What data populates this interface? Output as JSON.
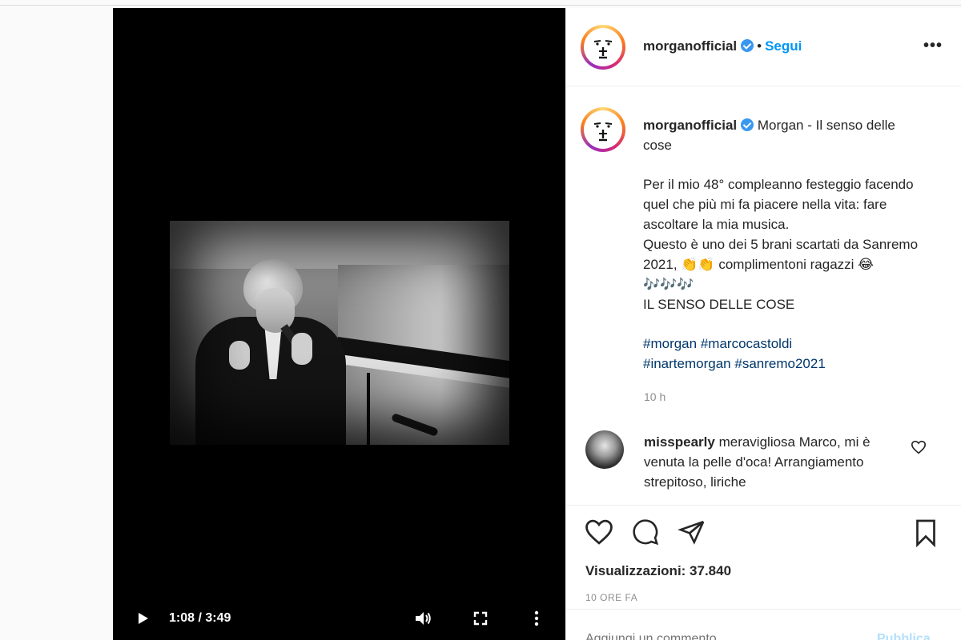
{
  "post": {
    "username": "morganofficial",
    "follow_label": "Segui",
    "more_label": "•••",
    "caption_title": "Morgan - Il senso delle cose",
    "caption_lines": [
      "Per il mio 48° compleanno festeggio facendo quel che più mi fa piacere nella vita: fare ascoltare la mia musica.",
      "Questo è uno dei 5 brani scartati da Sanremo 2021, 👏👏 complimentoni ragazzi 😂🎶🎶🎶",
      "IL SENSO DELLE COSE"
    ],
    "hashtags_line1": [
      "#morgan",
      "#marcocastoldi"
    ],
    "hashtags_line2": [
      "#inartemorgan",
      "#sanremo2021"
    ],
    "posted_time": "10 h"
  },
  "comment": {
    "username": "misspearly",
    "text": "meravigliosa Marco, mi è venuta la pelle d'oca! Arrangiamento strepitoso, liriche"
  },
  "stats": {
    "views_label": "Visualizzazioni: 37.840",
    "ago_label": "10 ORE FA"
  },
  "add_comment": {
    "placeholder": "Aggiungi un commento...",
    "publish_label": "Pubblica"
  },
  "video": {
    "time_label": "1:08 / 3:49"
  },
  "icons": {
    "verified": "verified-badge-icon",
    "like": "heart-icon",
    "comment": "comment-icon",
    "share": "paper-plane-icon",
    "save": "bookmark-icon",
    "play": "play-icon",
    "volume": "volume-icon",
    "fullscreen": "fullscreen-icon",
    "more": "more-vertical-icon"
  },
  "colors": {
    "link_blue": "#0095f6",
    "verified_blue": "#3897f0",
    "hashtag": "#00376b",
    "muted": "#8e8e8e"
  }
}
